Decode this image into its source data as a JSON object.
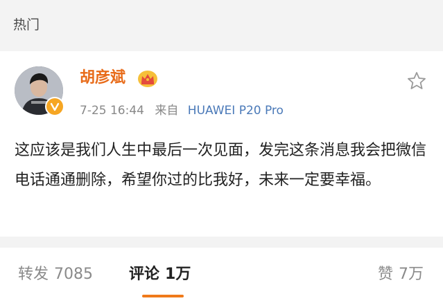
{
  "section": {
    "title": "热门"
  },
  "post": {
    "user_name": "胡彦斌",
    "time": "7-25 16:44",
    "from_label": "来自",
    "source": "HUAWEI P20 Pro",
    "content": "这应该是我们人生中最后一次见面，发完这条消息我会把微信电话通通删除，希望你过的比我好，未来一定要幸福。",
    "icons": {
      "favorite": "star-icon",
      "badge": "crown-icon",
      "verify": "verified-icon"
    }
  },
  "tabs": {
    "repost": {
      "label": "转发",
      "count": "7085"
    },
    "comment": {
      "label": "评论",
      "count": "1万"
    },
    "like": {
      "label": "赞",
      "count": "7万"
    }
  },
  "colors": {
    "name": "#e86b19",
    "source": "#4a79b8",
    "accent": "#f07a1a",
    "band": "#f3f3f3"
  }
}
